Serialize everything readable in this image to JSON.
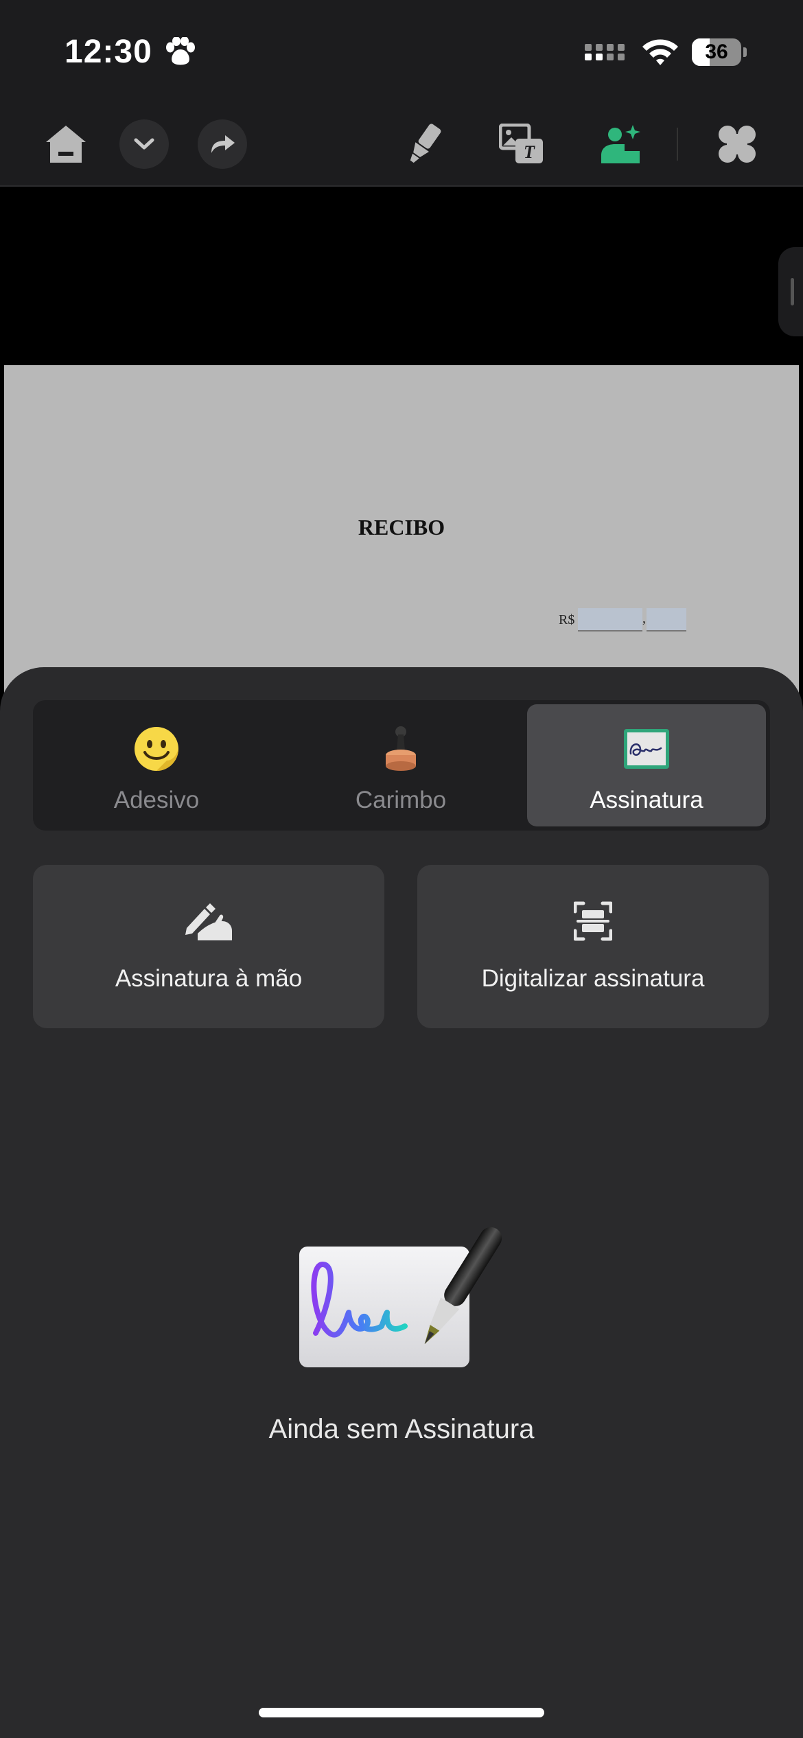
{
  "status_bar": {
    "time": "12:30",
    "battery_level": "36",
    "battery_fraction": 0.36
  },
  "toolbar": {
    "left_icons": [
      "home-icon",
      "chevron-down-icon",
      "redo-arrow-icon"
    ],
    "right_icons": [
      "highlighter-icon",
      "image-text-icon",
      "signature-stamp-icon",
      "app-grid-icon"
    ],
    "active_color": "#2fb67c"
  },
  "document": {
    "title": "RECIBO",
    "currency_label": "R$",
    "separator": ","
  },
  "sheet": {
    "tabs": [
      {
        "label": "Adesivo",
        "icon": "smiley-sticker-icon",
        "active": false
      },
      {
        "label": "Carimbo",
        "icon": "rubber-stamp-icon",
        "active": false
      },
      {
        "label": "Assinatura",
        "icon": "signature-card-icon",
        "active": true
      }
    ],
    "actions": [
      {
        "label": "Assinatura à mão",
        "icon": "hand-write-icon"
      },
      {
        "label": "Digitalizar assinatura",
        "icon": "scan-icon"
      }
    ],
    "empty_state": {
      "text": "Ainda sem Assinatura",
      "illustration": "signature-pen-illustration"
    }
  },
  "colors": {
    "background": "#000000",
    "panel": "#1c1c1e",
    "sheet": "#2a2a2c",
    "card": "#3a3a3c",
    "accent_green": "#2fb67c"
  }
}
